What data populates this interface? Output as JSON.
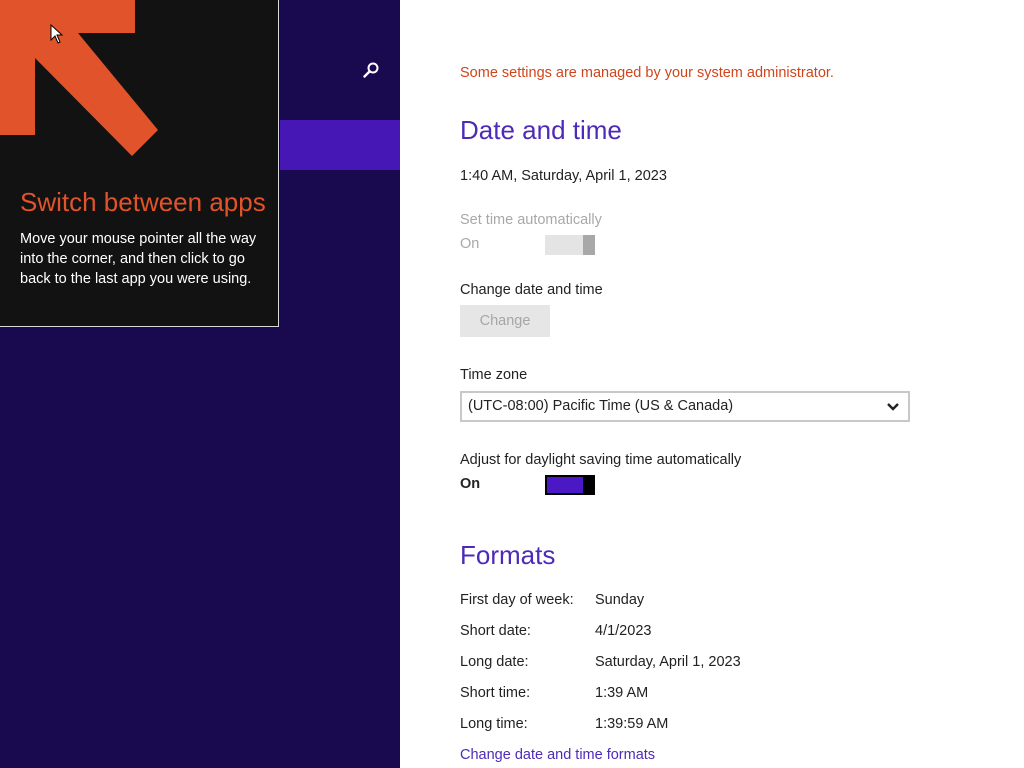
{
  "colors": {
    "left_background": "#190a4f",
    "selection": "#4617b4",
    "accent": "#4e2ab8",
    "warning": "#d0451b",
    "tip_background": "#121212",
    "tip_accent": "#e0532b"
  },
  "icons": {
    "search": "search-icon",
    "chevron": "chevron-down-icon",
    "tip_arrow": "arrow-up-left-icon",
    "cursor": "mouse-pointer-icon"
  },
  "tip": {
    "title": "Switch between apps",
    "body": "Move your mouse pointer all the way into the corner, and then click to go back to the last app you were using."
  },
  "settings": {
    "admin_notice": "Some settings are managed by your system administrator.",
    "date_time": {
      "heading": "Date and time",
      "current": "1:40 AM, Saturday, April 1, 2023",
      "set_auto_label": "Set time automatically",
      "set_auto_state": "On",
      "set_auto_on": true,
      "set_auto_enabled": false,
      "change_label": "Change date and time",
      "change_button": "Change",
      "time_zone_label": "Time zone",
      "time_zone_value": "(UTC-08:00) Pacific Time (US & Canada)",
      "dst_label": "Adjust for daylight saving time automatically",
      "dst_state": "On",
      "dst_on": true
    },
    "formats": {
      "heading": "Formats",
      "rows": [
        {
          "label": "First day of week:",
          "value": "Sunday"
        },
        {
          "label": "Short date:",
          "value": "4/1/2023"
        },
        {
          "label": "Long date:",
          "value": "Saturday, April 1, 2023"
        },
        {
          "label": "Short time:",
          "value": "1:39 AM"
        },
        {
          "label": "Long time:",
          "value": "1:39:59 AM"
        }
      ],
      "change_link": "Change date and time formats"
    }
  }
}
